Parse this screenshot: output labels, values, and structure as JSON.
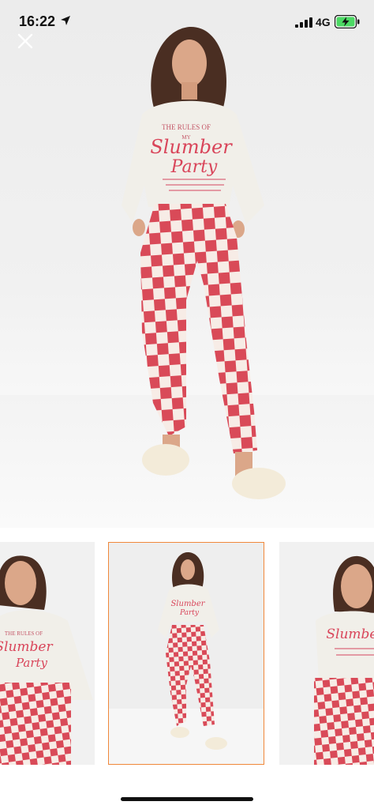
{
  "status_bar": {
    "time": "16:22",
    "network": "4G",
    "icons": [
      "location-arrow-icon",
      "signal-bars-icon",
      "battery-charging-icon"
    ]
  },
  "viewer": {
    "close_icon": "close-icon",
    "hero_image": "checkered-pajama-set-main-photo",
    "print_lines": [
      "THE RULES OF",
      "MY",
      "Slumber",
      "Party"
    ],
    "thumbnails": [
      {
        "name": "close-up-photo",
        "selected": false
      },
      {
        "name": "full-body-photo",
        "selected": true
      },
      {
        "name": "close-up-photo-alt",
        "selected": false
      }
    ]
  },
  "colors": {
    "selected_border": "#f0883a",
    "check_red": "#d94a58",
    "check_light": "#f7ece6"
  }
}
